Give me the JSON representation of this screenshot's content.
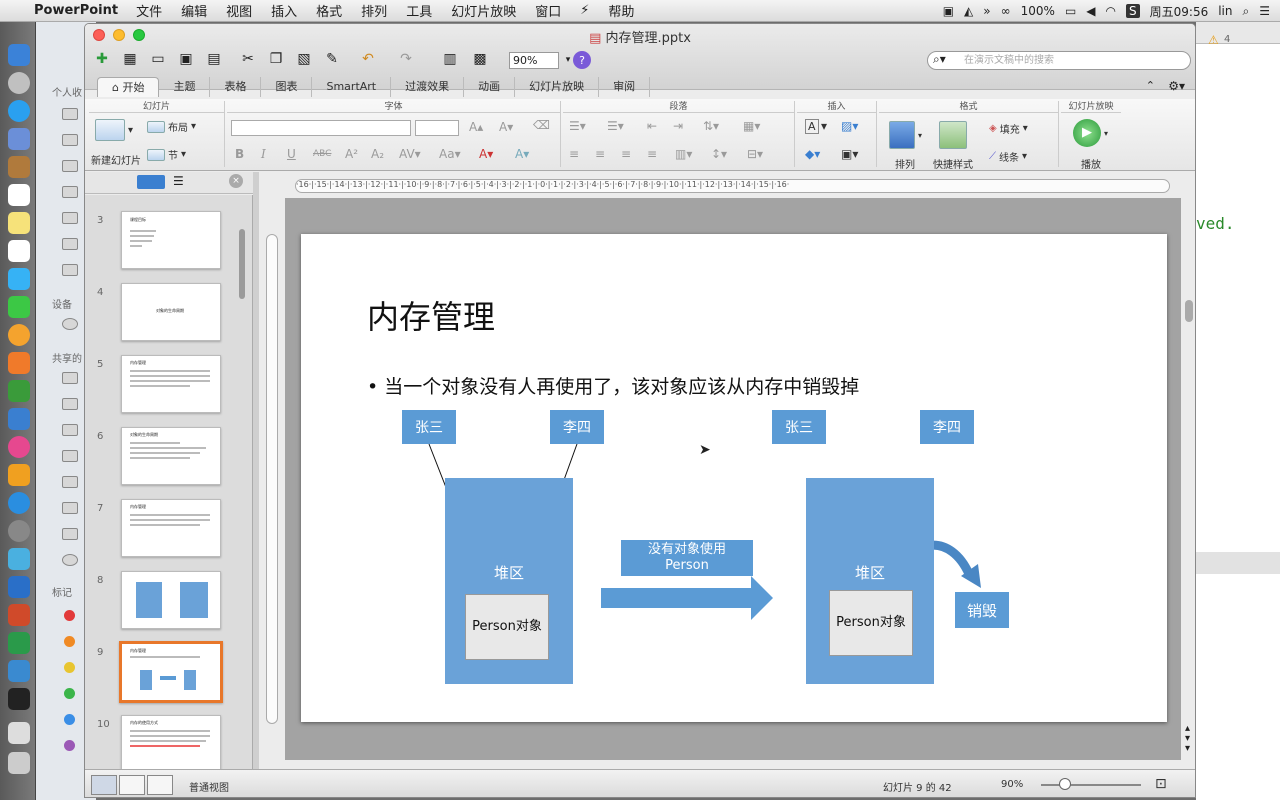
{
  "menubar": {
    "app_name": "PowerPoint",
    "items": [
      "文件",
      "编辑",
      "视图",
      "插入",
      "格式",
      "排列",
      "工具",
      "幻灯片放映",
      "窗口",
      "帮助"
    ],
    "battery": "100%",
    "clock": "周五09:56",
    "user": "lin"
  },
  "finder_sidebar": {
    "section_personal": "个人收",
    "section_devices": "设备",
    "section_shared": "共享的",
    "section_tags": "标记",
    "tag_colors": [
      "#e23a3a",
      "#f08a24",
      "#e8c530",
      "#3bb54a",
      "#3a8ee6",
      "#9b59b6"
    ]
  },
  "background_window": {
    "badge_count": "4",
    "terminal_text": "ved."
  },
  "window": {
    "title": "内存管理.pptx",
    "zoom": "90%",
    "search_placeholder": "在演示文稿中的搜索"
  },
  "ribbon_tabs": [
    "开始",
    "主题",
    "表格",
    "图表",
    "SmartArt",
    "过渡效果",
    "动画",
    "幻灯片放映",
    "审阅"
  ],
  "ribbon": {
    "group_slides": "幻灯片",
    "new_slide": "新建幻灯片",
    "layout": "布局",
    "section": "节",
    "group_font": "字体",
    "group_paragraph": "段落",
    "group_insert": "插入",
    "group_format": "格式",
    "arrange": "排列",
    "quick_styles": "快捷样式",
    "fill": "填充",
    "line": "线条",
    "group_slideshow": "幻灯片放映",
    "play": "播放"
  },
  "thumbnails": [
    {
      "num": "3",
      "title": "课程目标"
    },
    {
      "num": "4",
      "title": "对象的生命周期"
    },
    {
      "num": "5",
      "title": "内存管理"
    },
    {
      "num": "6",
      "title": "对象的生命周期"
    },
    {
      "num": "7",
      "title": "内存管理"
    },
    {
      "num": "8",
      "title": ""
    },
    {
      "num": "9",
      "title": "内存管理"
    },
    {
      "num": "10",
      "title": "内存的使用方式"
    }
  ],
  "ruler": {
    "horizontal": "·16·|·15·|·14·|·13·|·12·|·11·|·10·|·9·|·8·|·7·|·6·|·5·|·4·|·3·|·2·|·1·|·0·|·1·|·2·|·3·|·4·|·5·|·6·|·7·|·8·|·9·|·10·|·11·|·12·|·13·|·14·|·15·|·16·"
  },
  "slide": {
    "title": "内存管理",
    "bullet": "• 当一个对象没有人再使用了，该对象应该从内存中销毁掉",
    "left": {
      "person1": "张三",
      "person2": "李四",
      "heap": "堆区",
      "object": "Person对象"
    },
    "arrow_label": "没有对象使用Person",
    "right": {
      "person1": "张三",
      "person2": "李四",
      "heap": "堆区",
      "object": "Person对象",
      "destroy": "销毁"
    },
    "colors": {
      "box": "#5b9bd5",
      "heap": "#6aa2d8",
      "heap_dark": "#4a87c4"
    }
  },
  "statusbar": {
    "view_name": "普通视图",
    "slide_indicator": "幻灯片 9 的 42",
    "zoom": "90%"
  }
}
